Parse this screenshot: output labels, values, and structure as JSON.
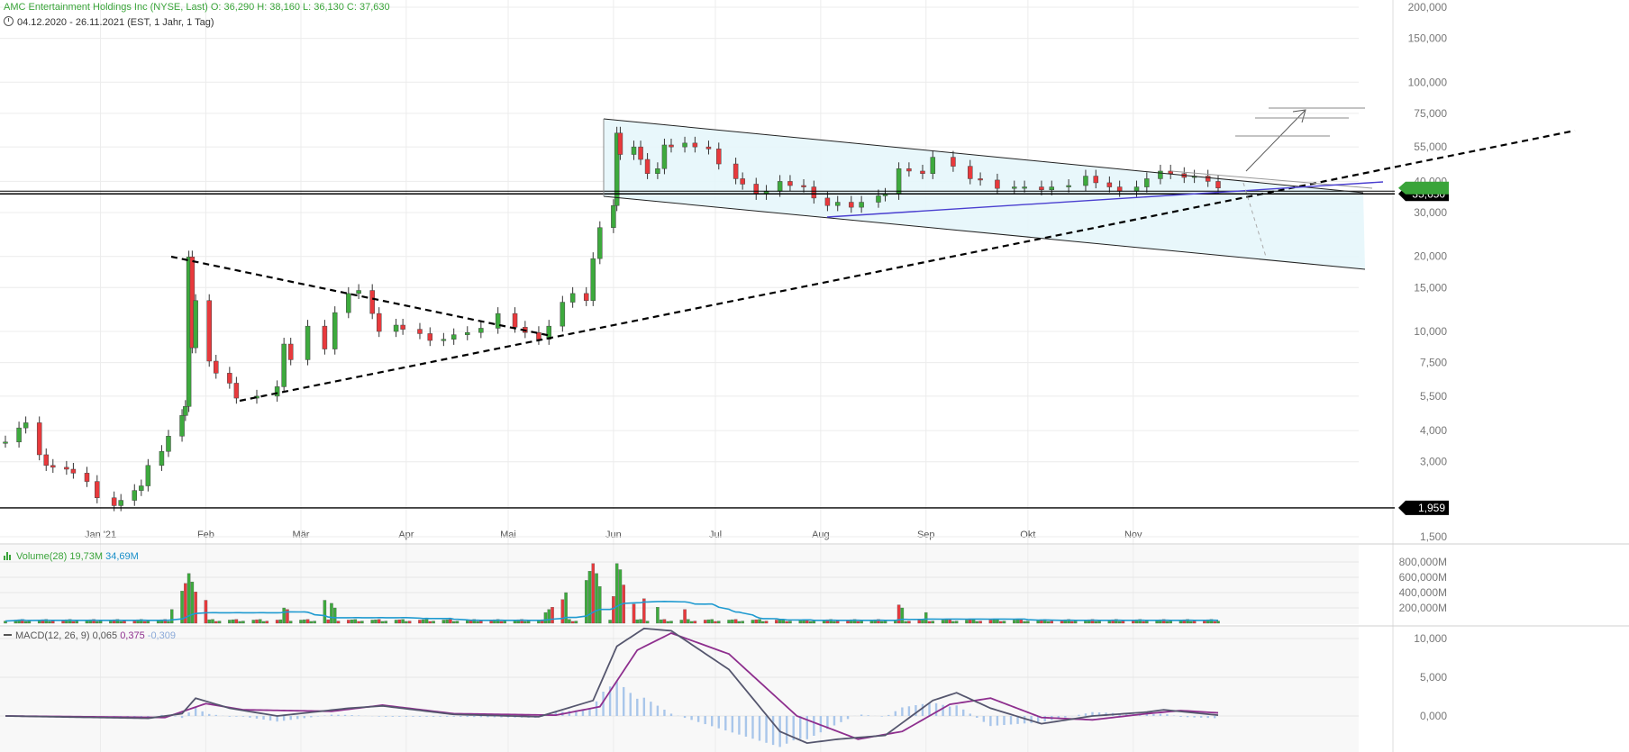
{
  "header": {
    "instrument": "AMC Entertainment Holdings Inc (NYSE, Last)",
    "ohlc": "O: 36,290   H: 38,160   L: 36,130   C: 37,630",
    "range": "04.12.2020 - 26.11.2021",
    "settings": "(EST, 1 Jahr, 1 Tag)"
  },
  "volume_panel": {
    "name": "Volume(28)",
    "v1": "19,73M",
    "v2": "34,69M"
  },
  "macd_panel": {
    "name": "MACD(12, 26, 9)",
    "v1": "0,065",
    "v2": "0,375",
    "v3": "-0,309"
  },
  "colors": {
    "up": "#3daa3d",
    "down": "#e8393c",
    "vol_ma": "#1f9ad0",
    "macd": "#55566e",
    "signal": "#8e2f8e",
    "hist": "#a9c6ea",
    "trend": "#4a3fd0",
    "price_tag": "#000000",
    "last_tag": "#3aa43a"
  },
  "chart_data": {
    "type": "candlestick",
    "scale": "log",
    "y_ticks": [
      "1,500",
      "3,000",
      "4,000",
      "5,500",
      "7,500",
      "10,000",
      "15,000",
      "20,000",
      "30,000",
      "40,000",
      "55,000",
      "75,000",
      "100,000",
      "150,000",
      "200,000"
    ],
    "y_tick_values": [
      1.5,
      3,
      4,
      5.5,
      7.5,
      10,
      15,
      20,
      30,
      40,
      55,
      75,
      100,
      150,
      200
    ],
    "x_ticks": [
      "Jan '21",
      "Feb",
      "Mär",
      "Apr",
      "Mai",
      "Jun",
      "Jul",
      "Aug",
      "Sep",
      "Okt",
      "Nov"
    ],
    "x_tick_dates": [
      "2021-01-01",
      "2021-02-01",
      "2021-03-01",
      "2021-04-01",
      "2021-05-01",
      "2021-06-01",
      "2021-07-01",
      "2021-08-01",
      "2021-09-01",
      "2021-10-01",
      "2021-11-01"
    ],
    "price_tags": [
      {
        "label": "35,650",
        "value": 35.65
      },
      {
        "label": "1,959",
        "value": 1.959
      }
    ],
    "last_close_value": 37.63,
    "close_series": [
      [
        "2020-12-04",
        3.6
      ],
      [
        "2020-12-08",
        4.1
      ],
      [
        "2020-12-10",
        4.3
      ],
      [
        "2020-12-14",
        3.2
      ],
      [
        "2020-12-16",
        2.9
      ],
      [
        "2020-12-18",
        2.85
      ],
      [
        "2020-12-22",
        2.8
      ],
      [
        "2020-12-24",
        2.7
      ],
      [
        "2020-12-28",
        2.5
      ],
      [
        "2020-12-31",
        2.15
      ],
      [
        "2021-01-05",
        2.0
      ],
      [
        "2021-01-07",
        2.1
      ],
      [
        "2021-01-11",
        2.3
      ],
      [
        "2021-01-13",
        2.4
      ],
      [
        "2021-01-15",
        2.9
      ],
      [
        "2021-01-19",
        3.3
      ],
      [
        "2021-01-21",
        3.8
      ],
      [
        "2021-01-25",
        4.6
      ],
      [
        "2021-01-26",
        5.0
      ],
      [
        "2021-01-27",
        19.9
      ],
      [
        "2021-01-28",
        8.6
      ],
      [
        "2021-01-29",
        13.3
      ],
      [
        "2021-02-02",
        7.6
      ],
      [
        "2021-02-04",
        6.8
      ],
      [
        "2021-02-08",
        6.2
      ],
      [
        "2021-02-10",
        5.4
      ],
      [
        "2021-02-16",
        5.5
      ],
      [
        "2021-02-22",
        6.0
      ],
      [
        "2021-02-24",
        8.9
      ],
      [
        "2021-02-26",
        7.7
      ],
      [
        "2021-03-03",
        10.5
      ],
      [
        "2021-03-08",
        8.5
      ],
      [
        "2021-03-11",
        11.9
      ],
      [
        "2021-03-15",
        14.2
      ],
      [
        "2021-03-18",
        14.6
      ],
      [
        "2021-03-22",
        11.8
      ],
      [
        "2021-03-24",
        10.0
      ],
      [
        "2021-03-29",
        10.6
      ],
      [
        "2021-03-31",
        10.2
      ],
      [
        "2021-04-05",
        9.8
      ],
      [
        "2021-04-08",
        9.2
      ],
      [
        "2021-04-12",
        9.3
      ],
      [
        "2021-04-15",
        9.7
      ],
      [
        "2021-04-19",
        9.9
      ],
      [
        "2021-04-23",
        10.3
      ],
      [
        "2021-04-28",
        11.8
      ],
      [
        "2021-05-03",
        10.4
      ],
      [
        "2021-05-06",
        9.9
      ],
      [
        "2021-05-10",
        9.3
      ],
      [
        "2021-05-13",
        10.5
      ],
      [
        "2021-05-17",
        13.1
      ],
      [
        "2021-05-20",
        14.2
      ],
      [
        "2021-05-24",
        13.3
      ],
      [
        "2021-05-26",
        19.6
      ],
      [
        "2021-05-28",
        26.1
      ],
      [
        "2021-06-01",
        32.0
      ],
      [
        "2021-06-02",
        62.5
      ],
      [
        "2021-06-03",
        51.3
      ],
      [
        "2021-06-07",
        55.0
      ],
      [
        "2021-06-09",
        49.0
      ],
      [
        "2021-06-11",
        43.0
      ],
      [
        "2021-06-14",
        45.0
      ],
      [
        "2021-06-16",
        56.0
      ],
      [
        "2021-06-18",
        55.0
      ],
      [
        "2021-06-22",
        57.0
      ],
      [
        "2021-06-25",
        55.0
      ],
      [
        "2021-06-29",
        54.0
      ],
      [
        "2021-07-02",
        47.0
      ],
      [
        "2021-07-07",
        41.0
      ],
      [
        "2021-07-09",
        39.0
      ],
      [
        "2021-07-13",
        35.5
      ],
      [
        "2021-07-16",
        36.5
      ],
      [
        "2021-07-20",
        40.0
      ],
      [
        "2021-07-23",
        38.5
      ],
      [
        "2021-07-27",
        38.0
      ],
      [
        "2021-07-30",
        34.3
      ],
      [
        "2021-08-03",
        32.0
      ],
      [
        "2021-08-06",
        33.0
      ],
      [
        "2021-08-10",
        31.5
      ],
      [
        "2021-08-13",
        33.0
      ],
      [
        "2021-08-18",
        35.0
      ],
      [
        "2021-08-20",
        35.5
      ],
      [
        "2021-08-24",
        45.0
      ],
      [
        "2021-08-27",
        44.0
      ],
      [
        "2021-08-31",
        43.0
      ],
      [
        "2021-09-03",
        50.0
      ],
      [
        "2021-09-09",
        46.0
      ],
      [
        "2021-09-14",
        41.0
      ],
      [
        "2021-09-17",
        40.5
      ],
      [
        "2021-09-22",
        37.5
      ],
      [
        "2021-09-27",
        38.0
      ],
      [
        "2021-09-30",
        38.0
      ],
      [
        "2021-10-05",
        37.0
      ],
      [
        "2021-10-08",
        38.0
      ],
      [
        "2021-10-13",
        38.5
      ],
      [
        "2021-10-18",
        42.0
      ],
      [
        "2021-10-21",
        39.5
      ],
      [
        "2021-10-25",
        38.0
      ],
      [
        "2021-10-28",
        36.5
      ],
      [
        "2021-11-02",
        38.0
      ],
      [
        "2021-11-05",
        41.0
      ],
      [
        "2021-11-09",
        44.0
      ],
      [
        "2021-11-12",
        43.0
      ],
      [
        "2021-11-16",
        41.5
      ],
      [
        "2021-11-19",
        42.0
      ],
      [
        "2021-11-23",
        40.0
      ],
      [
        "2021-11-26",
        37.63
      ]
    ],
    "volume": {
      "y_ticks": [
        "200,000M",
        "400,000M",
        "600,000M",
        "800,000M"
      ],
      "y_tick_values": [
        200,
        400,
        600,
        800
      ],
      "unit": "M",
      "spikes": [
        [
          "2021-01-22",
          180
        ],
        [
          "2021-01-25",
          420
        ],
        [
          "2021-01-26",
          520
        ],
        [
          "2021-01-27",
          650
        ],
        [
          "2021-01-28",
          540
        ],
        [
          "2021-01-29",
          410
        ],
        [
          "2021-02-01",
          300
        ],
        [
          "2021-02-24",
          200
        ],
        [
          "2021-02-25",
          180
        ],
        [
          "2021-03-08",
          300
        ],
        [
          "2021-03-10",
          260
        ],
        [
          "2021-03-11",
          200
        ],
        [
          "2021-05-12",
          140
        ],
        [
          "2021-05-13",
          180
        ],
        [
          "2021-05-14",
          210
        ],
        [
          "2021-05-17",
          310
        ],
        [
          "2021-05-18",
          400
        ],
        [
          "2021-05-24",
          560
        ],
        [
          "2021-05-25",
          680
        ],
        [
          "2021-05-26",
          780
        ],
        [
          "2021-05-27",
          650
        ],
        [
          "2021-05-28",
          480
        ],
        [
          "2021-06-01",
          350
        ],
        [
          "2021-06-02",
          780
        ],
        [
          "2021-06-03",
          700
        ],
        [
          "2021-06-04",
          500
        ],
        [
          "2021-06-07",
          250
        ],
        [
          "2021-06-10",
          320
        ],
        [
          "2021-06-14",
          210
        ],
        [
          "2021-06-22",
          180
        ],
        [
          "2021-08-24",
          240
        ],
        [
          "2021-08-25",
          200
        ],
        [
          "2021-09-01",
          140
        ]
      ],
      "base_volume": 40
    },
    "macd": {
      "y_ticks": [
        "0,000",
        "5,000",
        "10,000"
      ],
      "y_tick_values": [
        0,
        5,
        10
      ],
      "macd_line": [
        [
          "2020-12-04",
          0.0
        ],
        [
          "2021-01-15",
          -0.3
        ],
        [
          "2021-01-25",
          0.3
        ],
        [
          "2021-01-29",
          2.3
        ],
        [
          "2021-02-08",
          1.0
        ],
        [
          "2021-02-22",
          0.0
        ],
        [
          "2021-03-15",
          1.0
        ],
        [
          "2021-03-25",
          1.3
        ],
        [
          "2021-04-15",
          0.2
        ],
        [
          "2021-05-10",
          -0.1
        ],
        [
          "2021-05-26",
          2.0
        ],
        [
          "2021-06-02",
          9.0
        ],
        [
          "2021-06-10",
          11.3
        ],
        [
          "2021-06-18",
          11.0
        ],
        [
          "2021-07-05",
          6.0
        ],
        [
          "2021-07-20",
          -2.0
        ],
        [
          "2021-07-28",
          -3.5
        ],
        [
          "2021-08-06",
          -3.0
        ],
        [
          "2021-08-20",
          -2.5
        ],
        [
          "2021-09-03",
          2.0
        ],
        [
          "2021-09-10",
          3.0
        ],
        [
          "2021-09-20",
          1.0
        ],
        [
          "2021-10-05",
          -1.0
        ],
        [
          "2021-10-20",
          0.0
        ],
        [
          "2021-11-05",
          0.5
        ],
        [
          "2021-11-10",
          0.8
        ],
        [
          "2021-11-26",
          0.1
        ]
      ],
      "signal_line": [
        [
          "2020-12-04",
          0.0
        ],
        [
          "2021-01-20",
          -0.2
        ],
        [
          "2021-02-01",
          1.6
        ],
        [
          "2021-02-12",
          0.8
        ],
        [
          "2021-03-10",
          0.6
        ],
        [
          "2021-03-25",
          1.4
        ],
        [
          "2021-04-15",
          0.3
        ],
        [
          "2021-05-15",
          0.1
        ],
        [
          "2021-05-28",
          1.2
        ],
        [
          "2021-06-08",
          8.5
        ],
        [
          "2021-06-18",
          10.7
        ],
        [
          "2021-07-05",
          8.0
        ],
        [
          "2021-07-25",
          0.0
        ],
        [
          "2021-08-12",
          -3.0
        ],
        [
          "2021-08-25",
          -2.0
        ],
        [
          "2021-09-08",
          1.5
        ],
        [
          "2021-09-20",
          2.3
        ],
        [
          "2021-10-05",
          -0.2
        ],
        [
          "2021-10-20",
          -0.5
        ],
        [
          "2021-11-05",
          0.3
        ],
        [
          "2021-11-15",
          0.7
        ],
        [
          "2021-11-26",
          0.4
        ]
      ]
    }
  }
}
